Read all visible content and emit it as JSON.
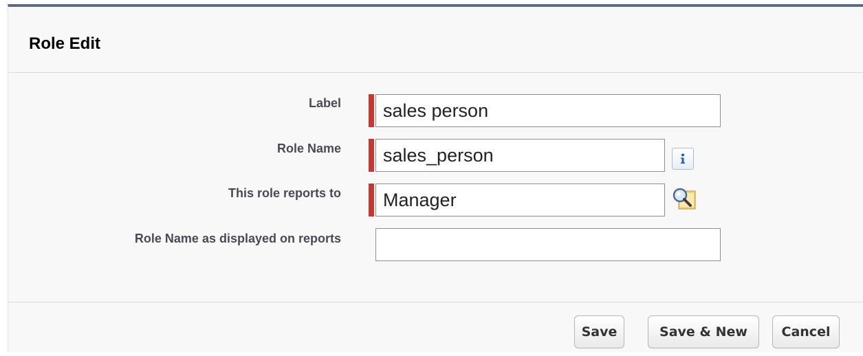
{
  "header": {
    "title": "Role Edit"
  },
  "form": {
    "label": {
      "label": "Label",
      "value": "sales person",
      "required": true
    },
    "role_name": {
      "label": "Role Name",
      "value": "sales_person",
      "required": true,
      "help_icon": "info-icon"
    },
    "reports_to": {
      "label": "This role reports to",
      "value": "Manager",
      "required": true,
      "lookup_icon": "lookup-magnifier-icon"
    },
    "display_name": {
      "label": "Role Name as displayed on reports",
      "value": "",
      "required": false
    }
  },
  "footer": {
    "save_label": "Save",
    "save_new_label": "Save & New",
    "cancel_label": "Cancel"
  },
  "colors": {
    "required_bar": "#c23934",
    "header_border": "#5a6b82",
    "panel_bg": "#f8f8f8"
  }
}
